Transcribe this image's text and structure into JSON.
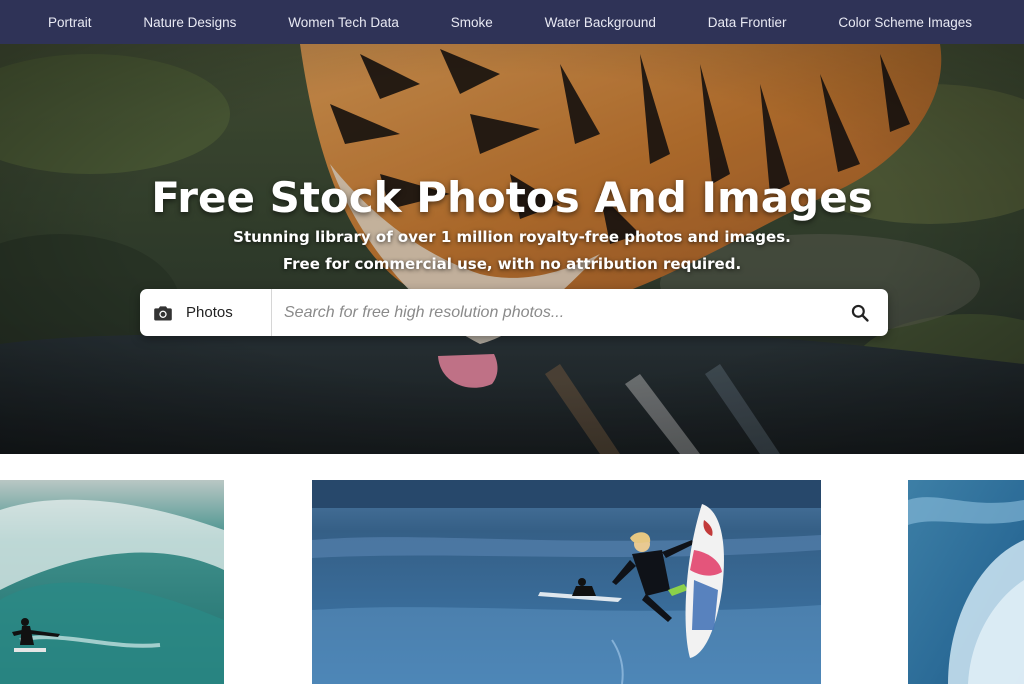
{
  "nav": {
    "items": [
      {
        "label": "Portrait"
      },
      {
        "label": "Nature Designs"
      },
      {
        "label": "Women Tech Data"
      },
      {
        "label": "Smoke"
      },
      {
        "label": "Water Background"
      },
      {
        "label": "Data Frontier"
      },
      {
        "label": "Color Scheme Images"
      }
    ]
  },
  "hero": {
    "title": "Free Stock Photos And Images",
    "subtitle_line1": "Stunning library of over 1 million royalty-free photos and images.",
    "subtitle_line2": "Free for commercial use, with no attribution required.",
    "image": "tiger-drinking-water-photo"
  },
  "search": {
    "type_icon": "camera-icon",
    "type_label": "Photos",
    "placeholder": "Search for free high resolution photos...",
    "value": "",
    "button_icon": "search-icon"
  },
  "gallery": {
    "items": [
      {
        "image": "surfer-in-wave-barrel-photo"
      },
      {
        "image": "surfer-jumping-with-board-photo"
      },
      {
        "image": "ocean-wave-photo"
      }
    ]
  },
  "colors": {
    "nav_bg": "#2f3357",
    "nav_text": "#e8e9f3",
    "hero_text": "#ffffff",
    "search_bg": "#ffffff"
  }
}
